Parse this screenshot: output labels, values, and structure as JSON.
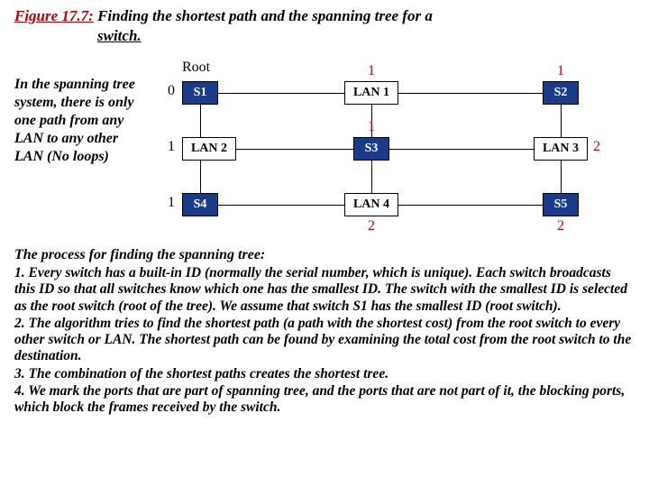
{
  "figure": {
    "number_label": "Figure 17.7:",
    "title_part1": " Finding the shortest path and the spanning tree for a",
    "title_part2": "switch."
  },
  "sidetext": "In the spanning tree system, there is only one path from any LAN to any other LAN (No loops)",
  "diagram": {
    "root_label": "Root",
    "switches": {
      "s1": "S1",
      "s2": "S2",
      "s3": "S3",
      "s4": "S4",
      "s5": "S5"
    },
    "lans": {
      "l1": "LAN 1",
      "l2": "LAN 2",
      "l3": "LAN 3",
      "l4": "LAN 4"
    },
    "costs": {
      "s1": "0",
      "s2_top": "1",
      "s3_top": "1",
      "s4_left": "1",
      "s5_bottom": "2",
      "lan1_top": "1",
      "lan2_left": "1",
      "lan3_right": "2",
      "lan4_bottom": "2"
    }
  },
  "process": {
    "heading": "The process for finding the spanning tree:",
    "p1": "1. Every switch has a built-in ID (normally the serial number, which is unique). Each switch broadcasts this ID so that all switches know which one has the smallest ID. The switch with the smallest ID is selected as the root switch (root of the tree). We assume that switch S1 has the smallest ID (root switch).",
    "p2": "2. The algorithm tries to find the shortest path (a path with the shortest cost) from the root switch to every other switch or LAN. The shortest path can be found by examining the total cost from the root switch to the destination.",
    "p3": "3. The combination of the shortest paths creates the shortest tree.",
    "p4": "4. We mark the ports that are part of spanning tree, and the ports that are not part of it, the blocking ports, which block the frames received by the switch."
  }
}
